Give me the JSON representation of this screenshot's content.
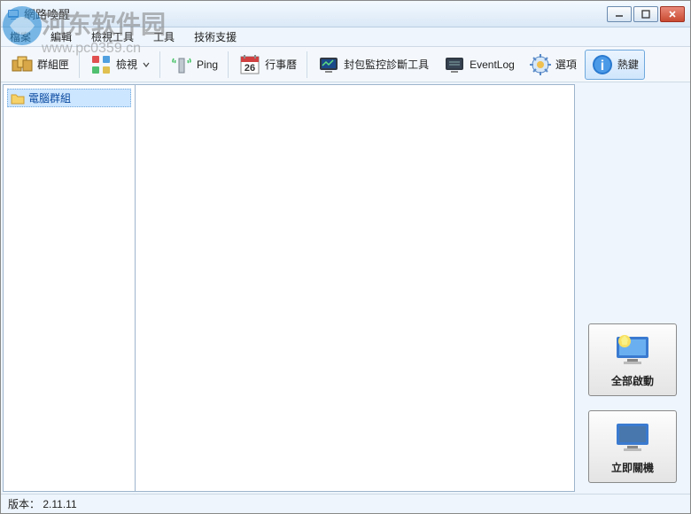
{
  "window": {
    "title": "網路喚醒"
  },
  "watermark": {
    "line1": "河东软件园",
    "line2": "www.pc0359.cn"
  },
  "menubar": {
    "items": [
      "檔案",
      "編輯",
      "檢視工具",
      "工具",
      "技術支援"
    ]
  },
  "toolbar": {
    "group_edit": "群組匣",
    "view": "檢視",
    "ping": "Ping",
    "calendar": "行事曆",
    "calendar_day": "26",
    "packet_tool": "封包監控診斷工具",
    "eventlog": "EventLog",
    "options": "選項",
    "hotkey": "熱鍵"
  },
  "tree": {
    "root_label": "電腦群組"
  },
  "right_buttons": {
    "wake_all": "全部啟動",
    "shutdown_now": "立即關機"
  },
  "statusbar": {
    "version_label": "版本：",
    "version": "2.11.11"
  }
}
